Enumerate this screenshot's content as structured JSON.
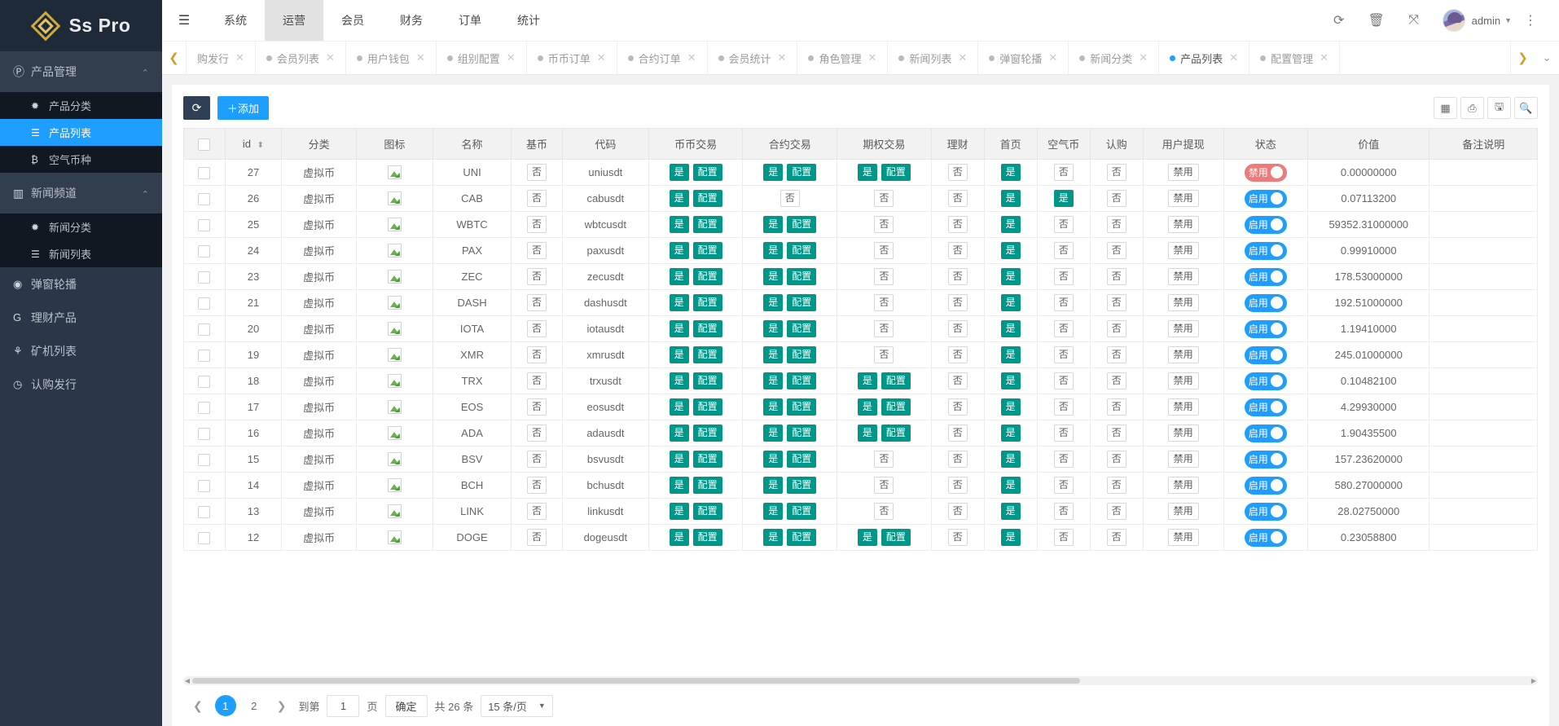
{
  "brand": {
    "name": "Ss Pro"
  },
  "sidebar": {
    "groups": [
      {
        "label": "产品管理",
        "icon": "P",
        "open": true,
        "children": [
          {
            "label": "产品分类",
            "icon": "✹",
            "active": false
          },
          {
            "label": "产品列表",
            "icon": "☰",
            "active": true
          },
          {
            "label": "空气币种",
            "icon": "₿",
            "active": false
          }
        ]
      },
      {
        "label": "新闻频道",
        "icon": "▥",
        "open": true,
        "children": [
          {
            "label": "新闻分类",
            "icon": "✹",
            "active": false
          },
          {
            "label": "新闻列表",
            "icon": "☰",
            "active": false
          }
        ]
      }
    ],
    "items": [
      {
        "label": "弹窗轮播",
        "icon": "◉"
      },
      {
        "label": "理财产品",
        "icon": "G"
      },
      {
        "label": "矿机列表",
        "icon": "⚘"
      },
      {
        "label": "认购发行",
        "icon": "◷"
      }
    ]
  },
  "topnav": {
    "collapse_icon": "☰",
    "items": [
      {
        "label": "系统",
        "active": false
      },
      {
        "label": "运营",
        "active": true
      },
      {
        "label": "会员",
        "active": false
      },
      {
        "label": "财务",
        "active": false
      },
      {
        "label": "订单",
        "active": false
      },
      {
        "label": "统计",
        "active": false
      }
    ],
    "right_icons": [
      "refresh-icon",
      "trash-icon",
      "fullscreen-icon"
    ],
    "user": "admin"
  },
  "tabs": {
    "left_arrow": "❮",
    "right_arrow": "❯",
    "down_arrow": "⌄",
    "items": [
      {
        "label": "购发行",
        "active": false,
        "first": true
      },
      {
        "label": "会员列表",
        "active": false
      },
      {
        "label": "用户钱包",
        "active": false
      },
      {
        "label": "组别配置",
        "active": false
      },
      {
        "label": "币币订单",
        "active": false
      },
      {
        "label": "合约订单",
        "active": false
      },
      {
        "label": "会员统计",
        "active": false
      },
      {
        "label": "角色管理",
        "active": false
      },
      {
        "label": "新闻列表",
        "active": false
      },
      {
        "label": "弹窗轮播",
        "active": false
      },
      {
        "label": "新闻分类",
        "active": false
      },
      {
        "label": "产品列表",
        "active": true
      },
      {
        "label": "配置管理",
        "active": false
      }
    ]
  },
  "toolbar": {
    "refresh_label": "⟳",
    "add_label": "＋添加",
    "right_icons": [
      "columns-icon",
      "print-icon",
      "export-icon",
      "search-icon"
    ]
  },
  "table": {
    "columns": [
      "",
      "id",
      "分类",
      "图标",
      "名称",
      "基币",
      "代码",
      "币币交易",
      "合约交易",
      "期权交易",
      "理财",
      "首页",
      "空气币",
      "认购",
      "用户提现",
      "状态",
      "价值",
      "备注说明"
    ],
    "rows": [
      {
        "id": "27",
        "cat": "虚拟币",
        "name": "UNI",
        "base": "否",
        "code": "uniusdt",
        "coin": [
          "是",
          "配置"
        ],
        "contract": [
          "是",
          "配置"
        ],
        "option": [
          "是",
          "配置"
        ],
        "fin": "否",
        "home": "是",
        "air": "否",
        "sub": "否",
        "withdraw": "禁用",
        "status": "禁用",
        "status_on": false,
        "value": "0.00000000",
        "remark": ""
      },
      {
        "id": "26",
        "cat": "虚拟币",
        "name": "CAB",
        "base": "否",
        "code": "cabusdt",
        "coin": [
          "是",
          "配置"
        ],
        "contract": [
          "否"
        ],
        "option": [
          "否"
        ],
        "fin": "否",
        "home": "是",
        "air": "是",
        "sub": "否",
        "withdraw": "禁用",
        "status": "启用",
        "status_on": true,
        "value": "0.07113200",
        "remark": ""
      },
      {
        "id": "25",
        "cat": "虚拟币",
        "name": "WBTC",
        "base": "否",
        "code": "wbtcusdt",
        "coin": [
          "是",
          "配置"
        ],
        "contract": [
          "是",
          "配置"
        ],
        "option": [
          "否"
        ],
        "fin": "否",
        "home": "是",
        "air": "否",
        "sub": "否",
        "withdraw": "禁用",
        "status": "启用",
        "status_on": true,
        "value": "59352.31000000",
        "remark": ""
      },
      {
        "id": "24",
        "cat": "虚拟币",
        "name": "PAX",
        "base": "否",
        "code": "paxusdt",
        "coin": [
          "是",
          "配置"
        ],
        "contract": [
          "是",
          "配置"
        ],
        "option": [
          "否"
        ],
        "fin": "否",
        "home": "是",
        "air": "否",
        "sub": "否",
        "withdraw": "禁用",
        "status": "启用",
        "status_on": true,
        "value": "0.99910000",
        "remark": ""
      },
      {
        "id": "23",
        "cat": "虚拟币",
        "name": "ZEC",
        "base": "否",
        "code": "zecusdt",
        "coin": [
          "是",
          "配置"
        ],
        "contract": [
          "是",
          "配置"
        ],
        "option": [
          "否"
        ],
        "fin": "否",
        "home": "是",
        "air": "否",
        "sub": "否",
        "withdraw": "禁用",
        "status": "启用",
        "status_on": true,
        "value": "178.53000000",
        "remark": ""
      },
      {
        "id": "21",
        "cat": "虚拟币",
        "name": "DASH",
        "base": "否",
        "code": "dashusdt",
        "coin": [
          "是",
          "配置"
        ],
        "contract": [
          "是",
          "配置"
        ],
        "option": [
          "否"
        ],
        "fin": "否",
        "home": "是",
        "air": "否",
        "sub": "否",
        "withdraw": "禁用",
        "status": "启用",
        "status_on": true,
        "value": "192.51000000",
        "remark": ""
      },
      {
        "id": "20",
        "cat": "虚拟币",
        "name": "IOTA",
        "base": "否",
        "code": "iotausdt",
        "coin": [
          "是",
          "配置"
        ],
        "contract": [
          "是",
          "配置"
        ],
        "option": [
          "否"
        ],
        "fin": "否",
        "home": "是",
        "air": "否",
        "sub": "否",
        "withdraw": "禁用",
        "status": "启用",
        "status_on": true,
        "value": "1.19410000",
        "remark": ""
      },
      {
        "id": "19",
        "cat": "虚拟币",
        "name": "XMR",
        "base": "否",
        "code": "xmrusdt",
        "coin": [
          "是",
          "配置"
        ],
        "contract": [
          "是",
          "配置"
        ],
        "option": [
          "否"
        ],
        "fin": "否",
        "home": "是",
        "air": "否",
        "sub": "否",
        "withdraw": "禁用",
        "status": "启用",
        "status_on": true,
        "value": "245.01000000",
        "remark": ""
      },
      {
        "id": "18",
        "cat": "虚拟币",
        "name": "TRX",
        "base": "否",
        "code": "trxusdt",
        "coin": [
          "是",
          "配置"
        ],
        "contract": [
          "是",
          "配置"
        ],
        "option": [
          "是",
          "配置"
        ],
        "fin": "否",
        "home": "是",
        "air": "否",
        "sub": "否",
        "withdraw": "禁用",
        "status": "启用",
        "status_on": true,
        "value": "0.10482100",
        "remark": ""
      },
      {
        "id": "17",
        "cat": "虚拟币",
        "name": "EOS",
        "base": "否",
        "code": "eosusdt",
        "coin": [
          "是",
          "配置"
        ],
        "contract": [
          "是",
          "配置"
        ],
        "option": [
          "是",
          "配置"
        ],
        "fin": "否",
        "home": "是",
        "air": "否",
        "sub": "否",
        "withdraw": "禁用",
        "status": "启用",
        "status_on": true,
        "value": "4.29930000",
        "remark": ""
      },
      {
        "id": "16",
        "cat": "虚拟币",
        "name": "ADA",
        "base": "否",
        "code": "adausdt",
        "coin": [
          "是",
          "配置"
        ],
        "contract": [
          "是",
          "配置"
        ],
        "option": [
          "是",
          "配置"
        ],
        "fin": "否",
        "home": "是",
        "air": "否",
        "sub": "否",
        "withdraw": "禁用",
        "status": "启用",
        "status_on": true,
        "value": "1.90435500",
        "remark": ""
      },
      {
        "id": "15",
        "cat": "虚拟币",
        "name": "BSV",
        "base": "否",
        "code": "bsvusdt",
        "coin": [
          "是",
          "配置"
        ],
        "contract": [
          "是",
          "配置"
        ],
        "option": [
          "否"
        ],
        "fin": "否",
        "home": "是",
        "air": "否",
        "sub": "否",
        "withdraw": "禁用",
        "status": "启用",
        "status_on": true,
        "value": "157.23620000",
        "remark": ""
      },
      {
        "id": "14",
        "cat": "虚拟币",
        "name": "BCH",
        "base": "否",
        "code": "bchusdt",
        "coin": [
          "是",
          "配置"
        ],
        "contract": [
          "是",
          "配置"
        ],
        "option": [
          "否"
        ],
        "fin": "否",
        "home": "是",
        "air": "否",
        "sub": "否",
        "withdraw": "禁用",
        "status": "启用",
        "status_on": true,
        "value": "580.27000000",
        "remark": ""
      },
      {
        "id": "13",
        "cat": "虚拟币",
        "name": "LINK",
        "base": "否",
        "code": "linkusdt",
        "coin": [
          "是",
          "配置"
        ],
        "contract": [
          "是",
          "配置"
        ],
        "option": [
          "否"
        ],
        "fin": "否",
        "home": "是",
        "air": "否",
        "sub": "否",
        "withdraw": "禁用",
        "status": "启用",
        "status_on": true,
        "value": "28.02750000",
        "remark": ""
      },
      {
        "id": "12",
        "cat": "虚拟币",
        "name": "DOGE",
        "base": "否",
        "code": "dogeusdt",
        "coin": [
          "是",
          "配置"
        ],
        "contract": [
          "是",
          "配置"
        ],
        "option": [
          "是",
          "配置"
        ],
        "fin": "否",
        "home": "是",
        "air": "否",
        "sub": "否",
        "withdraw": "禁用",
        "status": "启用",
        "status_on": true,
        "value": "0.23058800",
        "remark": ""
      }
    ]
  },
  "pager": {
    "prev": "❮",
    "next": "❯",
    "pages": [
      "1",
      "2"
    ],
    "current": "1",
    "goto_prefix": "到第",
    "goto_value": "1",
    "goto_suffix": "页",
    "confirm": "确定",
    "total": "共 26 条",
    "page_size": "15 条/页",
    "caret": "▼"
  },
  "colors": {
    "accent": "#1e9fff",
    "sidebar": "#2b3748",
    "green": "#009688",
    "red": "#ee7b7b",
    "gold": "#c9a227"
  }
}
